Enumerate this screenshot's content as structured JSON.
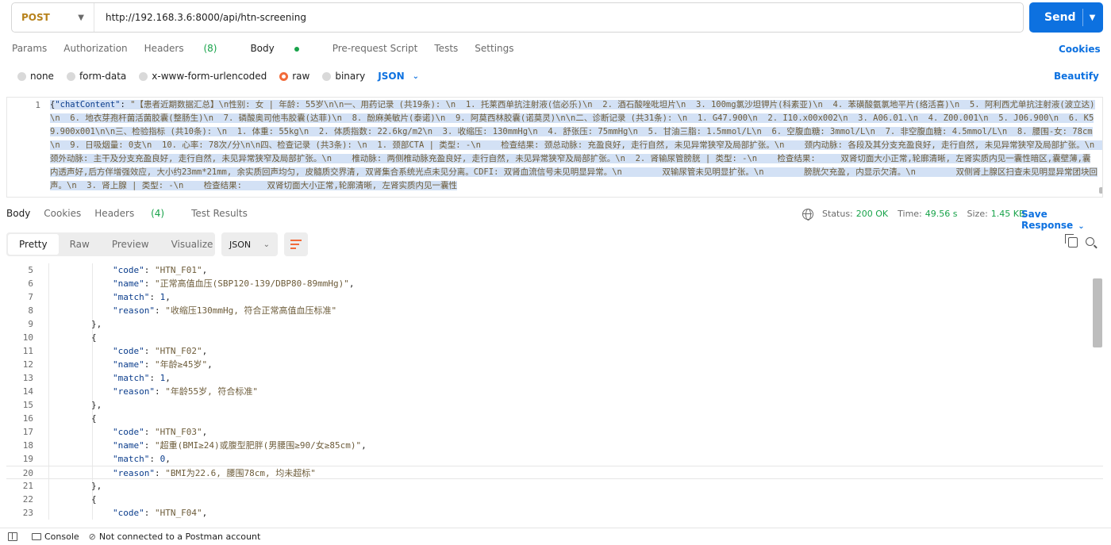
{
  "request": {
    "method": "POST",
    "url": "http://192.168.3.6:8000/api/htn-screening",
    "send_label": "Send"
  },
  "request_tabs": [
    "Params",
    "Authorization",
    "Headers",
    "(8)",
    "Body",
    "Pre-request Script",
    "Tests",
    "Settings"
  ],
  "cookies_label": "Cookies",
  "body_types": [
    "none",
    "form-data",
    "x-www-form-urlencoded",
    "raw",
    "binary"
  ],
  "body_format": "JSON",
  "beautify_label": "Beautify",
  "request_body": {
    "line_number": "1",
    "prefix": "{",
    "key": "\"chatContent\"",
    "colon": ": ",
    "value": "\"【患者近期数据汇总】\\n性别: 女 | 年龄: 55岁\\n\\n一、用药记录 (共19条): \\n  1. 托莱西单抗注射液(信必乐)\\n  2. 酒石酸唑吡坦片\\n  3. 100mg氯沙坦钾片(科素亚)\\n  4. 苯磺酸氨氯地平片(络活喜)\\n  5. 阿利西尤单抗注射液(波立达)\\n  6. 地衣芽孢杆菌活菌胶囊(整肠生)\\n  7. 磷酸奥司他韦胶囊(达菲)\\n  8. 酚麻美敏片(泰诺)\\n  9. 阿莫西林胶囊(诺莫灵)\\n\\n二、诊断记录 (共31条): \\n  1. G47.900\\n  2. I10.x00x002\\n  3. A06.01.\\n  4. Z00.001\\n  5. J06.900\\n  6. K59.900x001\\n\\n三、检验指标 (共10条): \\n  1. 体重: 55kg\\n  2. 体质指数: 22.6kg/m2\\n  3. 收缩压: 130mmHg\\n  4. 舒张压: 75mmHg\\n  5. 甘油三脂: 1.5mmol/L\\n  6. 空腹血糖: 3mmol/L\\n  7. 非空腹血糖: 4.5mmol/L\\n  8. 腰围-女: 78cm\\n  9. 日吸烟量: 0支\\n  10. 心率: 78次/分\\n\\n四、检查记录 (共3条): \\n  1. 颈部CTA | 类型: -\\n    检查结果: 颈总动脉: 充盈良好, 走行自然, 未见异常狭窄及局部扩张。\\n    颈内动脉: 各段及其分支充盈良好, 走行自然, 未见异常狭窄及局部扩张。\\n    颈外动脉: 主干及分支充盈良好, 走行自然, 未见异常狭窄及局部扩张。\\n    椎动脉: 两侧椎动脉充盈良好, 走行自然, 未见异常狭窄及局部扩张。\\n  2. 肾输尿管膀胱 | 类型: -\\n    检查结果:     双肾切面大小正常,轮廓清晰, 左肾实质内见一囊性暗区,囊壁薄,囊内透声好,后方伴增强效应, 大小约23mm*21mm, 余实质回声均匀, 皮髓质交界清, 双肾集合系统光点未见分离。CDFI: 双肾血流信号未见明显异常。\\n        双输尿管未见明显扩张。\\n        膀胱欠充盈, 内显示欠清。\\n        双侧肾上腺区扫查未见明显异常团块回声。\\n  3. 肾上腺 | 类型: -\\n    检查结果:     双肾切面大小正常,轮廓清晰, 左肾实质内见一囊性"
  },
  "response_tabs": [
    "Body",
    "Cookies",
    "Headers",
    "(4)",
    "Test Results"
  ],
  "response_stats": {
    "status_label": "Status:",
    "status_value": "200 OK",
    "time_label": "Time:",
    "time_value": "49.56 s",
    "size_label": "Size:",
    "size_value": "1.45 KB"
  },
  "save_response_label": "Save Response",
  "view_modes": [
    "Pretty",
    "Raw",
    "Preview",
    "Visualize"
  ],
  "response_format": "JSON",
  "response_lines": [
    {
      "n": "5",
      "indent": 2,
      "parts": [
        [
          "k",
          "\"code\""
        ],
        [
          "p",
          ": "
        ],
        [
          "s",
          "\"HTN_F01\""
        ],
        [
          "p",
          ","
        ]
      ]
    },
    {
      "n": "6",
      "indent": 2,
      "parts": [
        [
          "k",
          "\"name\""
        ],
        [
          "p",
          ": "
        ],
        [
          "s",
          "\"正常高值血压(SBP120-139/DBP80-89mmHg)\""
        ],
        [
          "p",
          ","
        ]
      ]
    },
    {
      "n": "7",
      "indent": 2,
      "parts": [
        [
          "k",
          "\"match\""
        ],
        [
          "p",
          ": "
        ],
        [
          "n",
          "1"
        ],
        [
          "p",
          ","
        ]
      ]
    },
    {
      "n": "8",
      "indent": 2,
      "parts": [
        [
          "k",
          "\"reason\""
        ],
        [
          "p",
          ": "
        ],
        [
          "s",
          "\"收缩压130mmHg, 符合正常高值血压标准\""
        ]
      ]
    },
    {
      "n": "9",
      "indent": 1,
      "parts": [
        [
          "p",
          "},"
        ]
      ]
    },
    {
      "n": "10",
      "indent": 1,
      "parts": [
        [
          "p",
          "{"
        ]
      ]
    },
    {
      "n": "11",
      "indent": 2,
      "parts": [
        [
          "k",
          "\"code\""
        ],
        [
          "p",
          ": "
        ],
        [
          "s",
          "\"HTN_F02\""
        ],
        [
          "p",
          ","
        ]
      ]
    },
    {
      "n": "12",
      "indent": 2,
      "parts": [
        [
          "k",
          "\"name\""
        ],
        [
          "p",
          ": "
        ],
        [
          "s",
          "\"年龄≥45岁\""
        ],
        [
          "p",
          ","
        ]
      ]
    },
    {
      "n": "13",
      "indent": 2,
      "parts": [
        [
          "k",
          "\"match\""
        ],
        [
          "p",
          ": "
        ],
        [
          "n",
          "1"
        ],
        [
          "p",
          ","
        ]
      ]
    },
    {
      "n": "14",
      "indent": 2,
      "parts": [
        [
          "k",
          "\"reason\""
        ],
        [
          "p",
          ": "
        ],
        [
          "s",
          "\"年龄55岁, 符合标准\""
        ]
      ]
    },
    {
      "n": "15",
      "indent": 1,
      "parts": [
        [
          "p",
          "},"
        ]
      ]
    },
    {
      "n": "16",
      "indent": 1,
      "parts": [
        [
          "p",
          "{"
        ]
      ]
    },
    {
      "n": "17",
      "indent": 2,
      "parts": [
        [
          "k",
          "\"code\""
        ],
        [
          "p",
          ": "
        ],
        [
          "s",
          "\"HTN_F03\""
        ],
        [
          "p",
          ","
        ]
      ]
    },
    {
      "n": "18",
      "indent": 2,
      "parts": [
        [
          "k",
          "\"name\""
        ],
        [
          "p",
          ": "
        ],
        [
          "s",
          "\"超重(BMI≥24)或腹型肥胖(男腰围≥90/女≥85cm)\""
        ],
        [
          "p",
          ","
        ]
      ]
    },
    {
      "n": "19",
      "indent": 2,
      "parts": [
        [
          "k",
          "\"match\""
        ],
        [
          "p",
          ": "
        ],
        [
          "n",
          "0"
        ],
        [
          "p",
          ","
        ]
      ]
    },
    {
      "n": "20",
      "indent": 2,
      "parts": [
        [
          "k",
          "\"reason\""
        ],
        [
          "p",
          ": "
        ],
        [
          "s",
          "\"BMI为22.6, 腰围78cm, 均未超标\""
        ]
      ]
    },
    {
      "n": "21",
      "indent": 1,
      "parts": [
        [
          "p",
          "},"
        ]
      ]
    },
    {
      "n": "22",
      "indent": 1,
      "parts": [
        [
          "p",
          "{"
        ]
      ]
    },
    {
      "n": "23",
      "indent": 2,
      "parts": [
        [
          "k",
          "\"code\""
        ],
        [
          "p",
          ": "
        ],
        [
          "s",
          "\"HTN_F04\""
        ],
        [
          "p",
          ","
        ]
      ]
    }
  ],
  "statusbar": {
    "console_label": "Console",
    "account_label": "Not connected to a Postman account"
  }
}
